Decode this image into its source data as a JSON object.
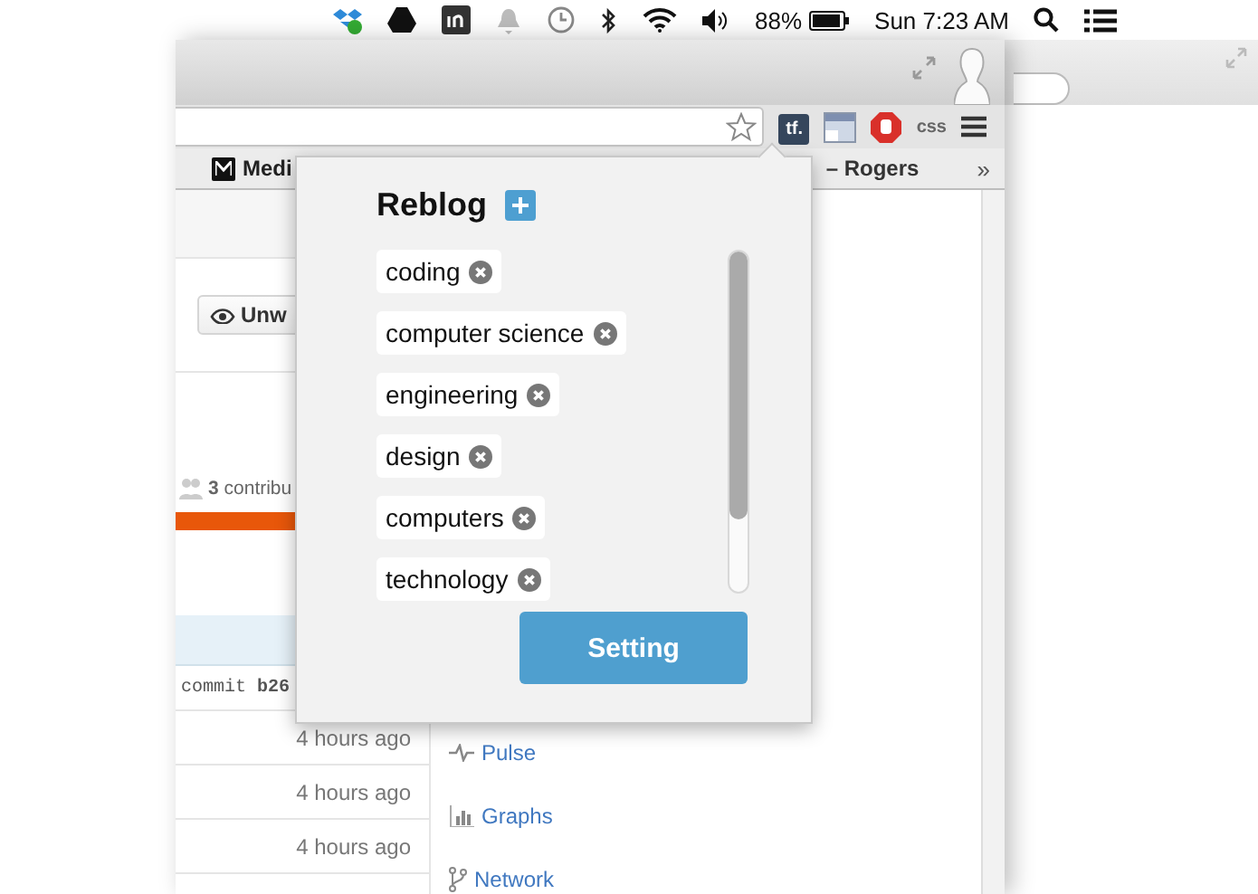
{
  "menu_bar": {
    "battery": "88%",
    "clock": "Sun 7:23 AM"
  },
  "browser": {
    "bookmarks": [
      {
        "label": "Medi",
        "kind": "medium"
      },
      {
        "label": "– Rogers",
        "kind": "plain"
      }
    ],
    "bookmarks_overflow": "»",
    "extensions": [
      {
        "kind": "tf",
        "label": "tf."
      },
      {
        "kind": "window"
      },
      {
        "kind": "stop"
      },
      {
        "kind": "css",
        "label": "css"
      }
    ]
  },
  "page": {
    "watch_button": "Unw",
    "contributors": "**3** contribu",
    "commit": "commit **b26**",
    "rows": [
      {
        "time": "4 hours ago"
      },
      {
        "time": "4 hours ago"
      },
      {
        "time": "4 hours ago"
      }
    ],
    "nav": [
      {
        "label": "Pulse",
        "kind": "pulse"
      },
      {
        "label": "Graphs",
        "kind": "graphs"
      },
      {
        "label": "Network",
        "kind": "network"
      }
    ]
  },
  "popup": {
    "title": "Reblog",
    "tags": [
      "coding",
      "computer science",
      "engineering",
      "design",
      "computers",
      "technology"
    ],
    "button": "Setting"
  }
}
